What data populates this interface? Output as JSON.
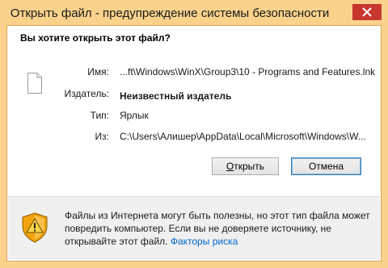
{
  "window": {
    "title": "Открыть файл - предупреждение системы безопасности"
  },
  "dialog": {
    "question": "Вы хотите открыть этот файл?",
    "fields": {
      "name_label": "Имя:",
      "name_value": "...ft\\Windows\\WinX\\Group3\\10 - Programs and Features.lnk",
      "publisher_label": "Издатель:",
      "publisher_value": "Неизвестный издатель",
      "type_label": "Тип:",
      "type_value": "Ярлык",
      "from_label": "Из:",
      "from_value": "C:\\Users\\Алишер\\AppData\\Local\\Microsoft\\Windows\\W..."
    },
    "buttons": {
      "open_prefix": "",
      "open_underlined": "О",
      "open_rest": "ткрыть",
      "cancel": "Отмена"
    }
  },
  "footer": {
    "warning_text": "Файлы из Интернета могут быть полезны, но этот тип файла может повредить компьютер. Если вы не доверяете источнику, не открывайте этот файл.",
    "risk_link": "Факторы риска"
  },
  "icons": {
    "close": "close-icon",
    "file": "file-icon",
    "shield": "warning-shield-icon"
  },
  "colors": {
    "title_bar": "#fbd28c",
    "close_button": "#c7372f",
    "link": "#0066cc",
    "footer_bg": "#f0f0f0"
  }
}
